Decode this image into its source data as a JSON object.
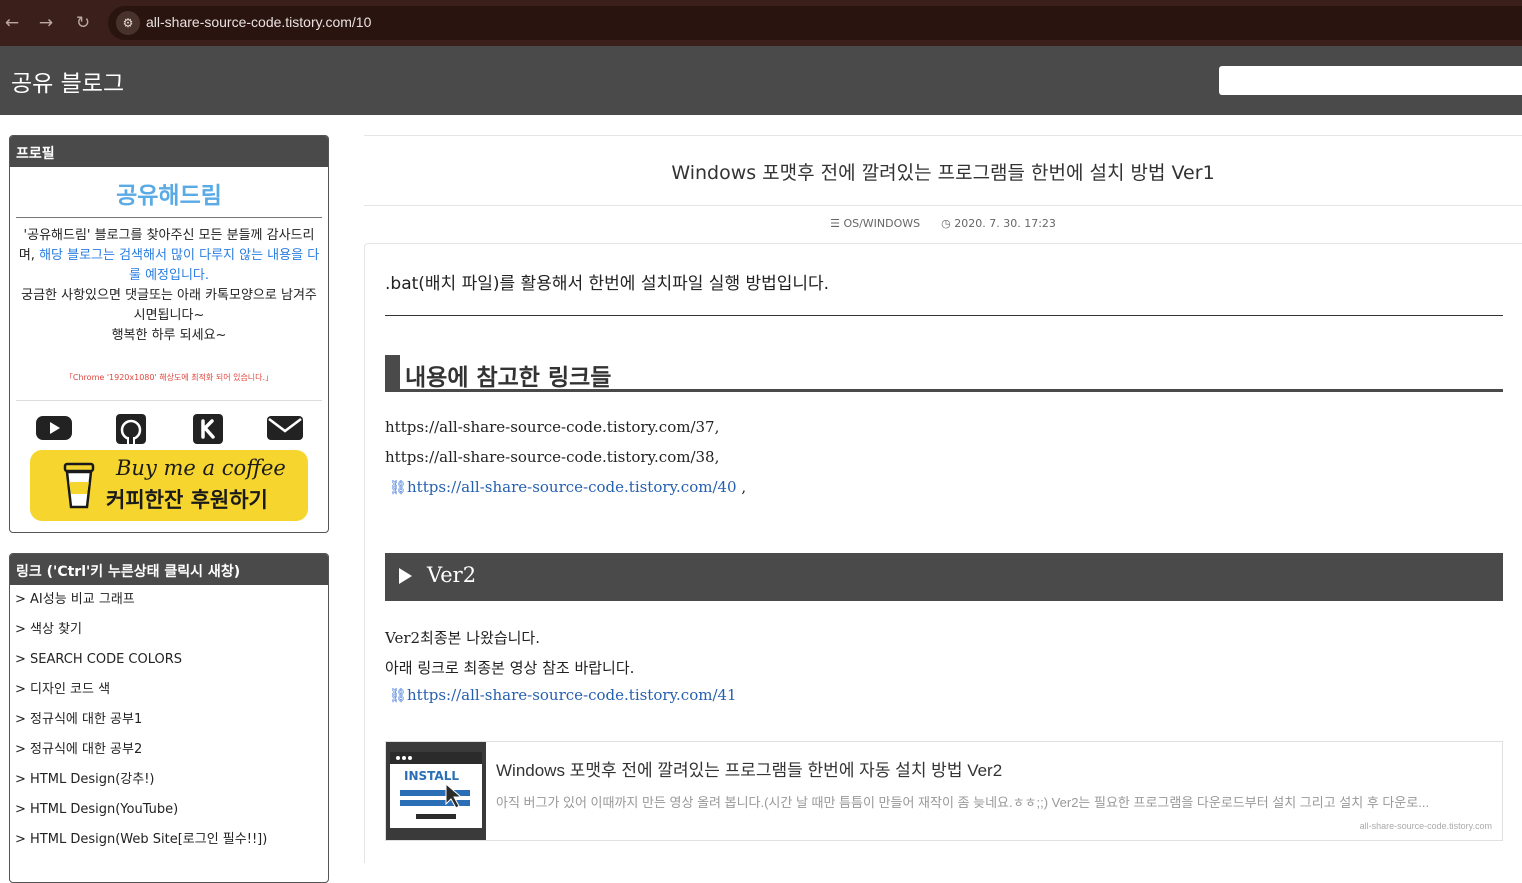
{
  "browser": {
    "url": "all-share-source-code.tistory.com/10",
    "back_icon": "arrow-left",
    "forward_icon": "arrow-right",
    "reload_icon": "reload"
  },
  "header": {
    "blog_title": "공유 블로그",
    "search_value": ""
  },
  "profile": {
    "heading": "프로필",
    "name": "공유해드림",
    "desc_part1": "'공유해드림' 블로그를 찾아주신 모든 분들께 감사드리며, ",
    "desc_highlight": "해당 블로그는 검색해서 많이 다루지 않는 내용을 다룰 예정입니다.",
    "desc_part2": "궁금한 사항있으면 댓글또는 아래 카톡모양으로 남겨주시면됩니다~",
    "desc_part3": "행복한 하루 되세요~",
    "note": "「Chrome '1920x1080' 해상도에 최적화 되어 있습니다.」",
    "icons": [
      "youtube-icon",
      "github-icon",
      "kakao-icon",
      "mail-icon"
    ],
    "coffee_line1": "Buy me a coffee",
    "coffee_line2": "커피한잔 후원하기"
  },
  "links": {
    "heading": "링크  ('Ctrl'키 누른상태 클릭시 새창)",
    "items": [
      "> AI성능 비교 그래프",
      "> 색상 찾기",
      "> SEARCH CODE COLORS",
      "> 디자인 코드 색",
      "> 정규식에 대한 공부1",
      "> 정규식에 대한 공부2",
      "> HTML Design(강추!)",
      "> HTML Design(YouTube)",
      "> HTML Design(Web Site[로그인 필수!!])"
    ]
  },
  "post": {
    "title": "Windows 포맷후 전에 깔려있는 프로그램들 한번에 설치 방법 Ver1",
    "category": "OS/WINDOWS",
    "date": "2020. 7. 30. 17:23",
    "intro": ".bat(배치 파일)를 활용해서 한번에 설치파일 실행 방법입니다.",
    "section_heading": "내용에 참고한 링크들",
    "ref_link1": "https://all-share-source-code.tistory.com/37,",
    "ref_link2": "https://all-share-source-code.tistory.com/38,",
    "ref_link3": "https://all-share-source-code.tistory.com/40",
    "ref_link3_tail": " ,",
    "fold_label": "Ver2",
    "ver2_line1": "Ver2최종본 나왔습니다.",
    "ver2_line2": "아래 링크로 최종본 영상 참조 바랍니다.",
    "ver2_link": "https://all-share-source-code.tistory.com/41",
    "card": {
      "thumb_label": "INSTALL",
      "title": "Windows 포맷후 전에 깔려있는 프로그램들 한번에 자동 설치 방법 Ver2",
      "desc": "아직 버그가 있어 이때까지 만든 영상 올려 봅니다.(시간 날 때만 틈틈이 만들어 재작이 좀 늦네요.ㅎㅎ;;) Ver2는 필요한 프로그램을 다운로드부터 설치 그리고 설치 후 다운로...",
      "url": "all-share-source-code.tistory.com"
    }
  },
  "colors": {
    "header_bg": "#4a4a4a",
    "browser_bg": "#3b1f1a",
    "profile_name": "#5aaae6",
    "link_blue": "#2560b0",
    "coffee_yellow": "#f6d62e"
  }
}
